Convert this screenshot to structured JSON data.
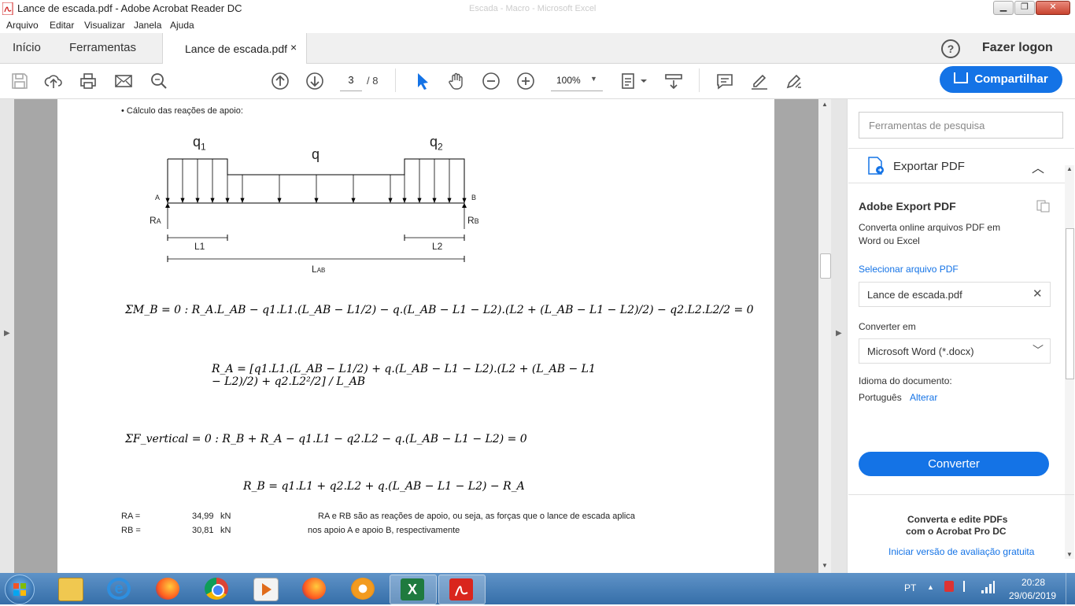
{
  "window": {
    "title": "Lance de escada.pdf - Adobe Acrobat Reader DC",
    "ghost_title": "Escada - Macro - Microsoft Excel"
  },
  "menu": [
    "Arquivo",
    "Editar",
    "Visualizar",
    "Janela",
    "Ajuda"
  ],
  "tabs": {
    "home": "Início",
    "tools": "Ferramentas",
    "document": "Lance de escada.pdf",
    "close": "×"
  },
  "account": {
    "help": "?",
    "login": "Fazer logon"
  },
  "toolbar": {
    "page_current": "3",
    "page_total": "/ 8",
    "zoom": "100%",
    "share": "Compartilhar"
  },
  "document": {
    "bullet": "• Cálculo das reações de apoio:",
    "diagram": {
      "q1": "q",
      "q1_sub": "1",
      "q": "q",
      "q2": "q",
      "q2_sub": "2",
      "A": "A",
      "B": "B",
      "RA": "R",
      "RA_sub": "A",
      "RB": "R",
      "RB_sub": "B",
      "L1": "L1",
      "L2": "L2",
      "LAB": "L",
      "LAB_sub": "AB"
    },
    "eq1": "ΣM_B = 0 :   R_A.L_AB − q1.L1.(L_AB − L1/2) − q.(L_AB − L1 − L2).(L2 + (L_AB − L1 − L2)/2) − q2.L2.L2/2 = 0",
    "eq2": "R_A = [q1.L1.(L_AB − L1/2) + q.(L_AB − L1 − L2).(L2 + (L_AB − L1 − L2)/2) + q2.L2²/2] / L_AB",
    "eq3": "ΣF_vertical = 0 :   R_B + R_A − q1.L1 − q2.L2 − q.(L_AB − L1 − L2) = 0",
    "eq4": "R_B = q1.L1 + q2.L2 + q.(L_AB − L1 − L2) − R_A",
    "results": [
      {
        "label": "RA =",
        "value": "34,99",
        "unit": "kN"
      },
      {
        "label": "RB =",
        "value": "30,81",
        "unit": "kN"
      }
    ],
    "note_line1": "RA e RB são as reações de apoio, ou seja, as forças que o lance de escada aplica",
    "note_line2": "nos apoio A e apoio B, respectivamente"
  },
  "panel": {
    "search_placeholder": "Ferramentas de pesquisa",
    "export_title": "Exportar PDF",
    "adobe_export": "Adobe Export PDF",
    "desc_line1": "Converta online arquivos PDF em",
    "desc_line2": "Word ou Excel",
    "select_file": "Selecionar arquivo PDF",
    "file_name": "Lance de escada.pdf",
    "convert_to_label": "Converter em",
    "format": "Microsoft Word (*.docx)",
    "language_label": "Idioma do documento:",
    "language": "Português",
    "change": "Alterar",
    "convert_button": "Converter",
    "promo_line1": "Converta e edite PDFs",
    "promo_line2": "com o Acrobat Pro DC",
    "trial_link": "Iniciar versão de avaliação gratuita"
  },
  "taskbar": {
    "lang": "PT",
    "time": "20:28",
    "date": "29/06/2019"
  },
  "colors": {
    "accent": "#1473e6",
    "viewer_bg": "#a7a7a7",
    "taskbar": "#4a82bd"
  }
}
